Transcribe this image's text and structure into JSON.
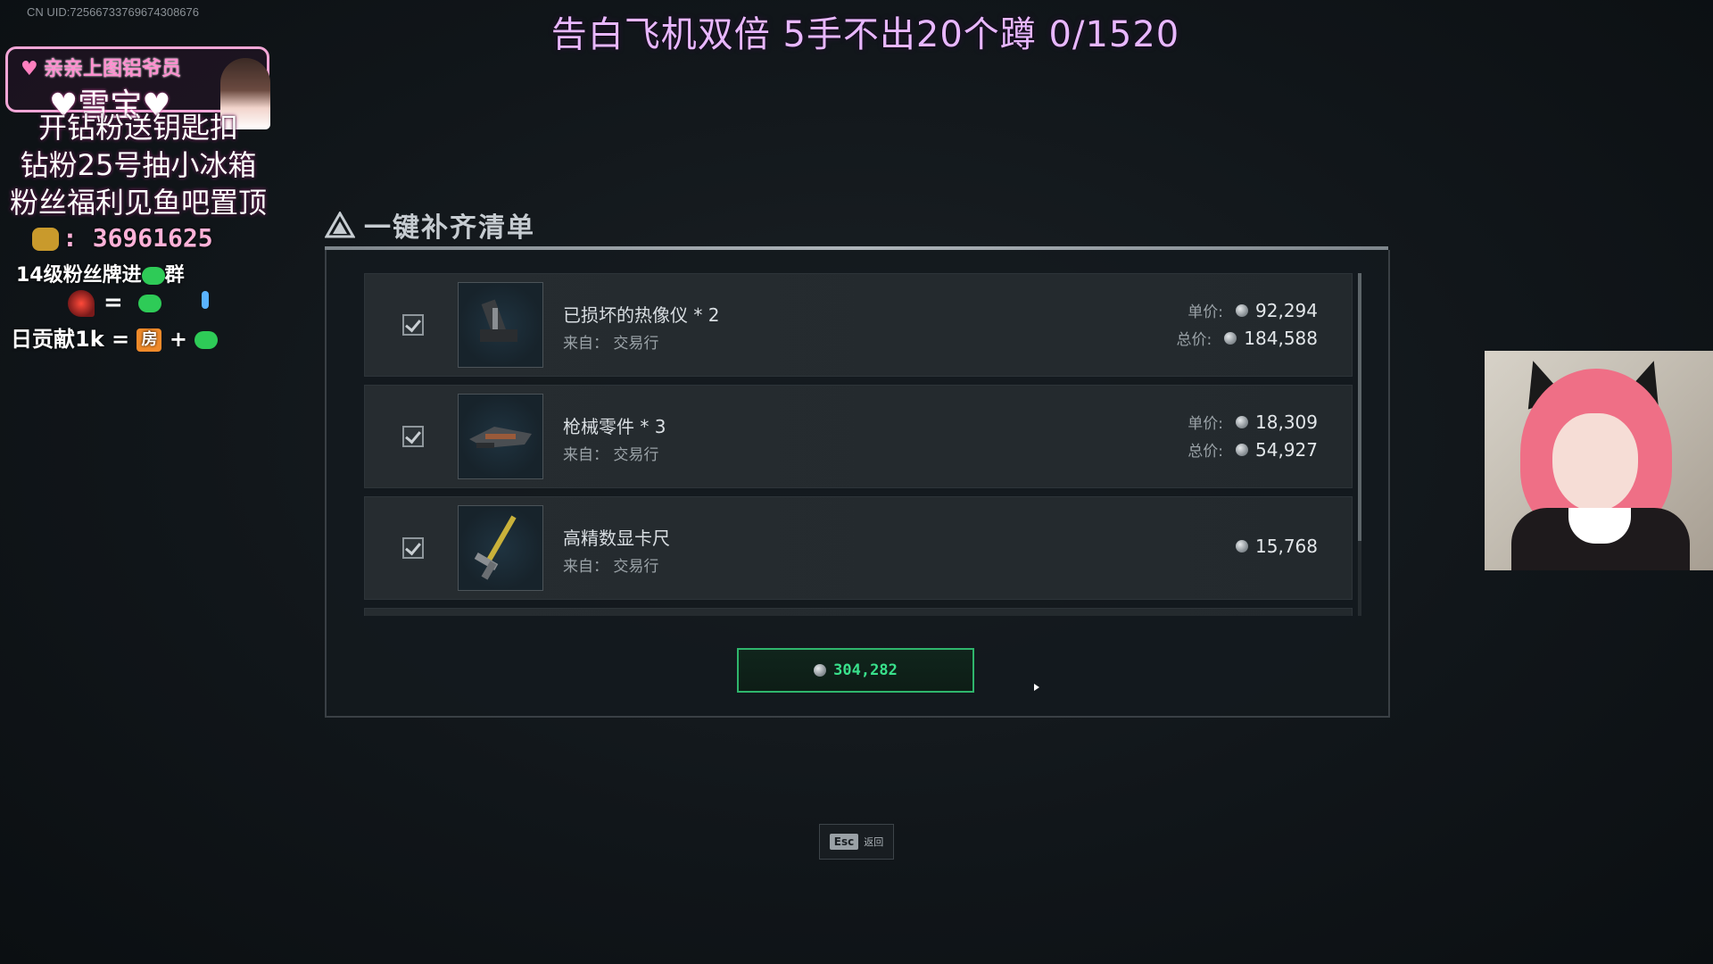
{
  "stream": {
    "uid": "CN UID:72566733769674308676",
    "title": "告白飞机双倍 5手不出20个蹲 0/1520"
  },
  "overlay": {
    "host_tag": "亲亲上图铝爷员",
    "host_name": "♥雪宝♥",
    "promo_lines": [
      "开钻粉送钥匙扣",
      "钻粉25号抽小冰箱",
      "粉丝福利见鱼吧置顶"
    ],
    "contact_number": ": 36961625",
    "fans_text": "14级粉丝牌进",
    "fans_suffix": "群",
    "rocket_equals": "=",
    "contrib_text": "日贡献1k =",
    "contrib_plus": "+",
    "room_badge": "房"
  },
  "panel": {
    "title": "一键补齐清单",
    "items": [
      {
        "name": "已损坏的热像仪 * 2",
        "source": "来自：  交易行",
        "unit_label": "单价:",
        "unit_price": "92,294",
        "total_label": "总价:",
        "total_price": "184,588",
        "checked": true,
        "icon": "thermal-imager-icon"
      },
      {
        "name": "枪械零件 * 3",
        "source": "来自：  交易行",
        "unit_label": "单价:",
        "unit_price": "18,309",
        "total_label": "总价:",
        "total_price": "54,927",
        "checked": true,
        "icon": "gun-parts-icon"
      },
      {
        "name": "高精数显卡尺",
        "source": "来自：  交易行",
        "price": "15,768",
        "checked": true,
        "icon": "caliper-icon"
      }
    ],
    "total": "304,282",
    "esc_key": "Esc",
    "esc_label": "返回"
  },
  "colors": {
    "accent_green": "#39e08b",
    "title_pink": "#e8b7ff",
    "panel_bg": "#141a1e"
  }
}
